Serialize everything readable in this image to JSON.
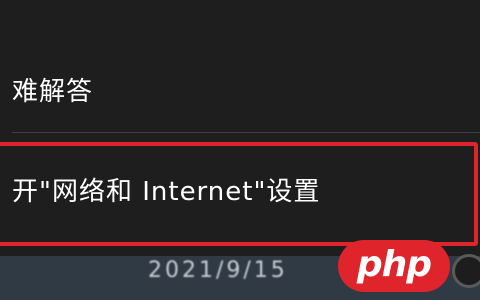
{
  "context_menu": {
    "items": [
      {
        "label": "难解答"
      },
      {
        "label": "开\"网络和 Internet\"设置"
      }
    ]
  },
  "taskbar": {
    "clock": "2021/9/15"
  },
  "watermark": {
    "text": "php"
  },
  "colors": {
    "menu_bg": "#1e1e1e",
    "highlight": "#e0242b",
    "taskbar_bg": "#2f3a45",
    "text": "#ffffff"
  }
}
